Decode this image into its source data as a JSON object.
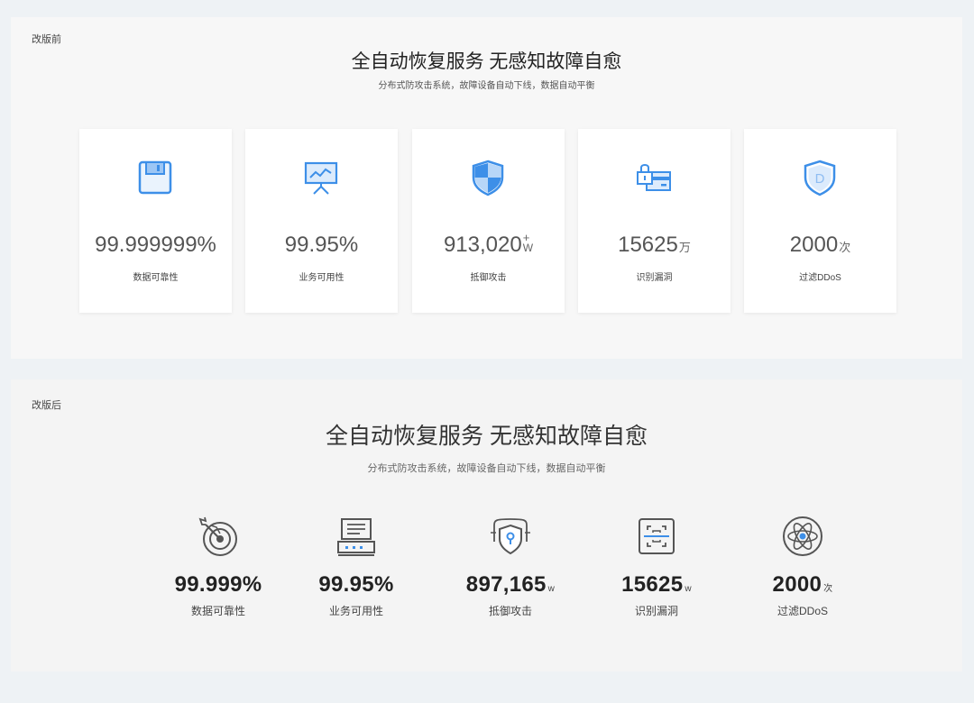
{
  "before": {
    "tag": "改版前",
    "title": "全自动恢复服务 无感知故障自愈",
    "subtitle": "分布式防攻击系统，故障设备自动下线，数据自动平衡",
    "accent": "#3d8fe8",
    "cards": [
      {
        "icon": "floppy-disk-icon",
        "value": "99.999999%",
        "unit": "",
        "label": "数据可靠性"
      },
      {
        "icon": "presentation-chart-icon",
        "value": "99.95%",
        "unit": "",
        "label": "业务可用性"
      },
      {
        "icon": "shield-icon",
        "value": "913,020",
        "unit_top": "+",
        "unit": "W",
        "label": "抵御攻击"
      },
      {
        "icon": "lock-card-icon",
        "value": "15625",
        "unit": "万",
        "label": "识别漏洞"
      },
      {
        "icon": "shield-d-icon",
        "value": "2000",
        "unit": "次",
        "label": "过滤DDoS"
      }
    ]
  },
  "after": {
    "tag": "改版后",
    "title": "全自动恢复服务 无感知故障自愈",
    "subtitle": "分布式防攻击系统，故障设备自动下线，数据自动平衡",
    "stats": [
      {
        "icon": "target-dart-icon",
        "value": "99.999%",
        "unit": "",
        "label": "数据可靠性"
      },
      {
        "icon": "server-icon",
        "value": "99.95%",
        "unit": "",
        "label": "业务可用性"
      },
      {
        "icon": "shield-keyhole-icon",
        "value": "897,165",
        "unit": "w",
        "label": "抵御攻击"
      },
      {
        "icon": "scan-frame-icon",
        "value": "15625",
        "unit": "w",
        "label": "识别漏洞"
      },
      {
        "icon": "atom-icon",
        "value": "2000",
        "unit": "次",
        "label": "过滤DDoS"
      }
    ]
  }
}
